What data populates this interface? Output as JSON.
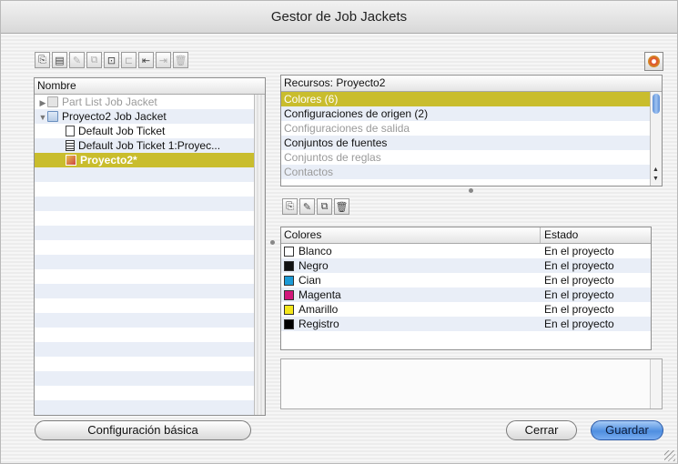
{
  "window": {
    "title": "Gestor de Job Jackets"
  },
  "top_toolbar": {
    "buttons": [
      {
        "name": "new-job-jacket-icon",
        "glyph": "⎘",
        "enabled": true
      },
      {
        "name": "new-job-ticket-icon",
        "glyph": "▤",
        "enabled": true
      },
      {
        "name": "edit-icon",
        "glyph": "✎",
        "enabled": false
      },
      {
        "name": "duplicate-icon",
        "glyph": "⧉",
        "enabled": false
      },
      {
        "name": "link-icon",
        "glyph": "⊡",
        "enabled": true
      },
      {
        "name": "open-icon",
        "glyph": "⊏",
        "enabled": false
      },
      {
        "name": "import-icon",
        "glyph": "⇤",
        "enabled": true
      },
      {
        "name": "export-icon",
        "glyph": "⇥",
        "enabled": false
      },
      {
        "name": "delete-icon",
        "glyph": "🗑",
        "enabled": false
      }
    ]
  },
  "tree": {
    "header": "Nombre",
    "items": [
      {
        "label": "Part List Job Jacket",
        "level": 0,
        "expander": "▶",
        "icon": "job-jacket-icon",
        "dim": true,
        "selected": false
      },
      {
        "label": "Proyecto2 Job Jacket",
        "level": 0,
        "expander": "▼",
        "icon": "job-jacket-icon",
        "dim": false,
        "selected": false
      },
      {
        "label": "Default Job Ticket",
        "level": 1,
        "expander": "",
        "icon": "job-ticket-icon",
        "dim": false,
        "selected": false
      },
      {
        "label": "Default Job Ticket 1:Proyec...",
        "level": 1,
        "expander": "",
        "icon": "job-ticket-linked-icon",
        "dim": false,
        "selected": false
      },
      {
        "label": "Proyecto2*",
        "level": 1,
        "expander": "",
        "icon": "project-icon",
        "dim": false,
        "selected": true
      }
    ]
  },
  "resources": {
    "header": "Recursos: Proyecto2",
    "items": [
      {
        "label": "Colores (6)",
        "selected": true,
        "dim": false
      },
      {
        "label": "Configuraciones de origen (2)",
        "selected": false,
        "dim": false
      },
      {
        "label": "Configuraciones de salida",
        "selected": false,
        "dim": true
      },
      {
        "label": "Conjuntos de fuentes",
        "selected": false,
        "dim": false
      },
      {
        "label": "Conjuntos de reglas",
        "selected": false,
        "dim": true
      },
      {
        "label": "Contactos",
        "selected": false,
        "dim": true
      }
    ]
  },
  "resource_toolbar": {
    "buttons": [
      {
        "name": "new-resource-icon",
        "glyph": "⎘",
        "enabled": true
      },
      {
        "name": "edit-resource-icon",
        "glyph": "✎",
        "enabled": true
      },
      {
        "name": "duplicate-resource-icon",
        "glyph": "⧉",
        "enabled": true
      },
      {
        "name": "delete-resource-icon",
        "glyph": "🗑",
        "enabled": true
      }
    ]
  },
  "colors_table": {
    "columns": [
      "Colores",
      "Estado"
    ],
    "rows": [
      {
        "name": "Blanco",
        "status": "En el proyecto",
        "swatch": "#ffffff"
      },
      {
        "name": "Negro",
        "status": "En el proyecto",
        "swatch": "#111111"
      },
      {
        "name": "Cian",
        "status": "En el proyecto",
        "swatch": "#1c9ad6"
      },
      {
        "name": "Magenta",
        "status": "En el proyecto",
        "swatch": "#d1167a"
      },
      {
        "name": "Amarillo",
        "status": "En el proyecto",
        "swatch": "#f4e61b"
      },
      {
        "name": "Registro",
        "status": "En el proyecto",
        "swatch": "#000000"
      }
    ]
  },
  "buttons": {
    "basic_settings": "Configuración básica",
    "close": "Cerrar",
    "save": "Guardar"
  },
  "colors": {
    "selection": "#c9bd2d",
    "primary_button": "#4f8fe0"
  }
}
